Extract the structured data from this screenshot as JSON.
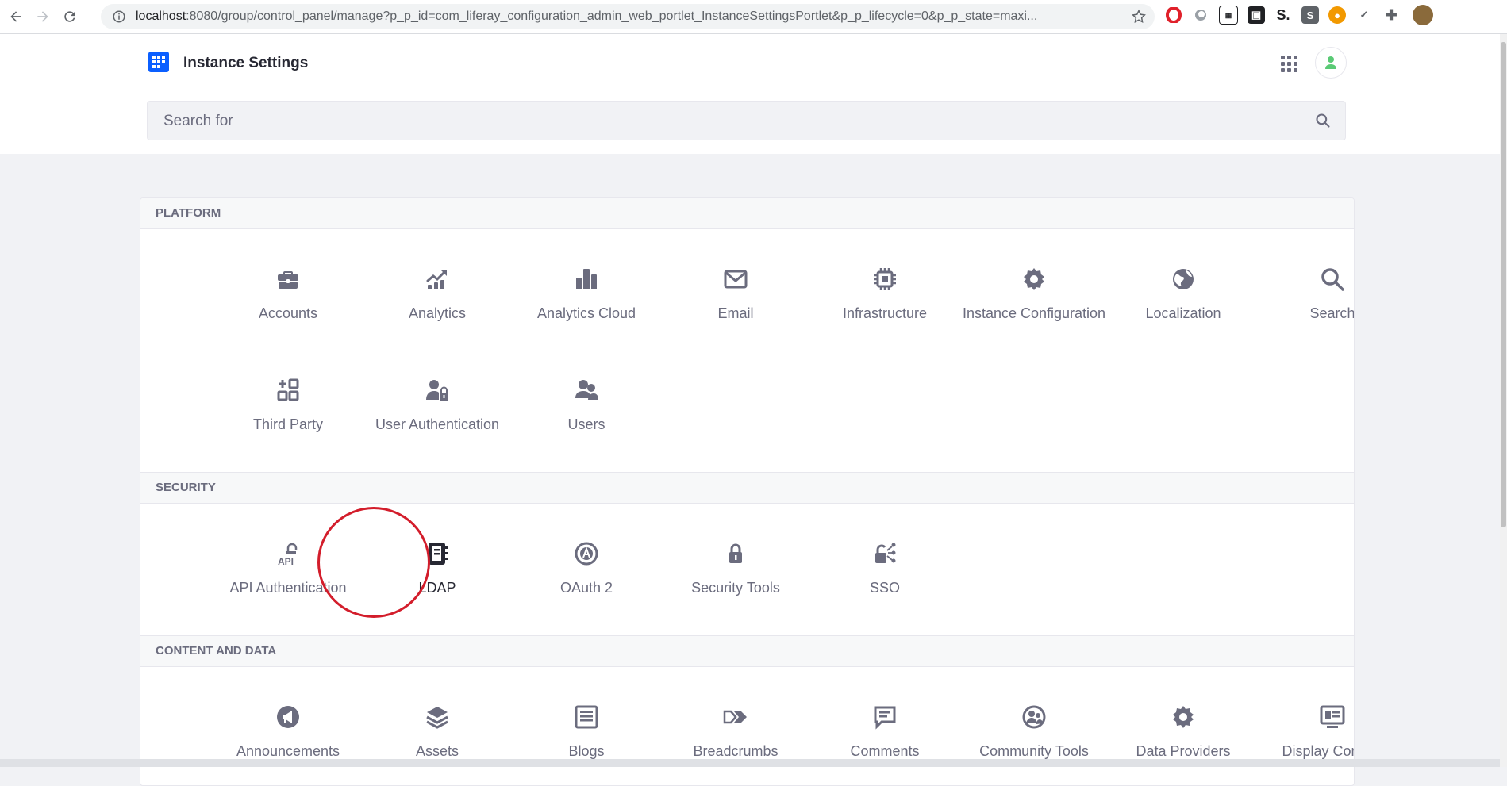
{
  "browser": {
    "url_host": "localhost",
    "url_rest": ":8080/group/control_panel/manage?p_p_id=com_liferay_configuration_admin_web_portlet_InstanceSettingsPortlet&p_p_lifecycle=0&p_p_state=maxi...",
    "extensions": [
      "opera-icon",
      "circle-icon",
      "news-icon",
      "tab-icon",
      "s-icon",
      "s-box-icon",
      "fox-icon",
      "check-icon",
      "puzzle-icon",
      "profile-icon"
    ]
  },
  "header": {
    "title": "Instance Settings"
  },
  "search": {
    "placeholder": "Search for"
  },
  "sections": {
    "platform": {
      "label": "PLATFORM",
      "items": [
        {
          "label": "Accounts",
          "icon": "briefcase-icon"
        },
        {
          "label": "Analytics",
          "icon": "analytics-icon"
        },
        {
          "label": "Analytics Cloud",
          "icon": "bar-chart-icon"
        },
        {
          "label": "Email",
          "icon": "envelope-icon"
        },
        {
          "label": "Infrastructure",
          "icon": "chip-icon"
        },
        {
          "label": "Instance Configuration",
          "icon": "gear-icon"
        },
        {
          "label": "Localization",
          "icon": "globe-icon"
        },
        {
          "label": "Search",
          "icon": "search-icon"
        },
        {
          "label": "Third Party",
          "icon": "third-party-icon"
        },
        {
          "label": "User Authentication",
          "icon": "user-lock-icon"
        },
        {
          "label": "Users",
          "icon": "users-icon"
        }
      ]
    },
    "security": {
      "label": "SECURITY",
      "items": [
        {
          "label": "API Authentication",
          "icon": "api-lock-icon"
        },
        {
          "label": "LDAP",
          "icon": "address-book-icon"
        },
        {
          "label": "OAuth 2",
          "icon": "oauth-icon"
        },
        {
          "label": "Security Tools",
          "icon": "lock-icon"
        },
        {
          "label": "SSO",
          "icon": "sso-icon"
        }
      ]
    },
    "content": {
      "label": "CONTENT AND DATA",
      "items": [
        {
          "label": "Announcements",
          "icon": "megaphone-icon"
        },
        {
          "label": "Assets",
          "icon": "layers-icon"
        },
        {
          "label": "Blogs",
          "icon": "blog-icon"
        },
        {
          "label": "Breadcrumbs",
          "icon": "breadcrumb-icon"
        },
        {
          "label": "Comments",
          "icon": "comment-icon"
        },
        {
          "label": "Community Tools",
          "icon": "community-icon"
        },
        {
          "label": "Data Providers",
          "icon": "gear-icon"
        },
        {
          "label": "Display Content",
          "icon": "display-icon"
        }
      ]
    }
  }
}
